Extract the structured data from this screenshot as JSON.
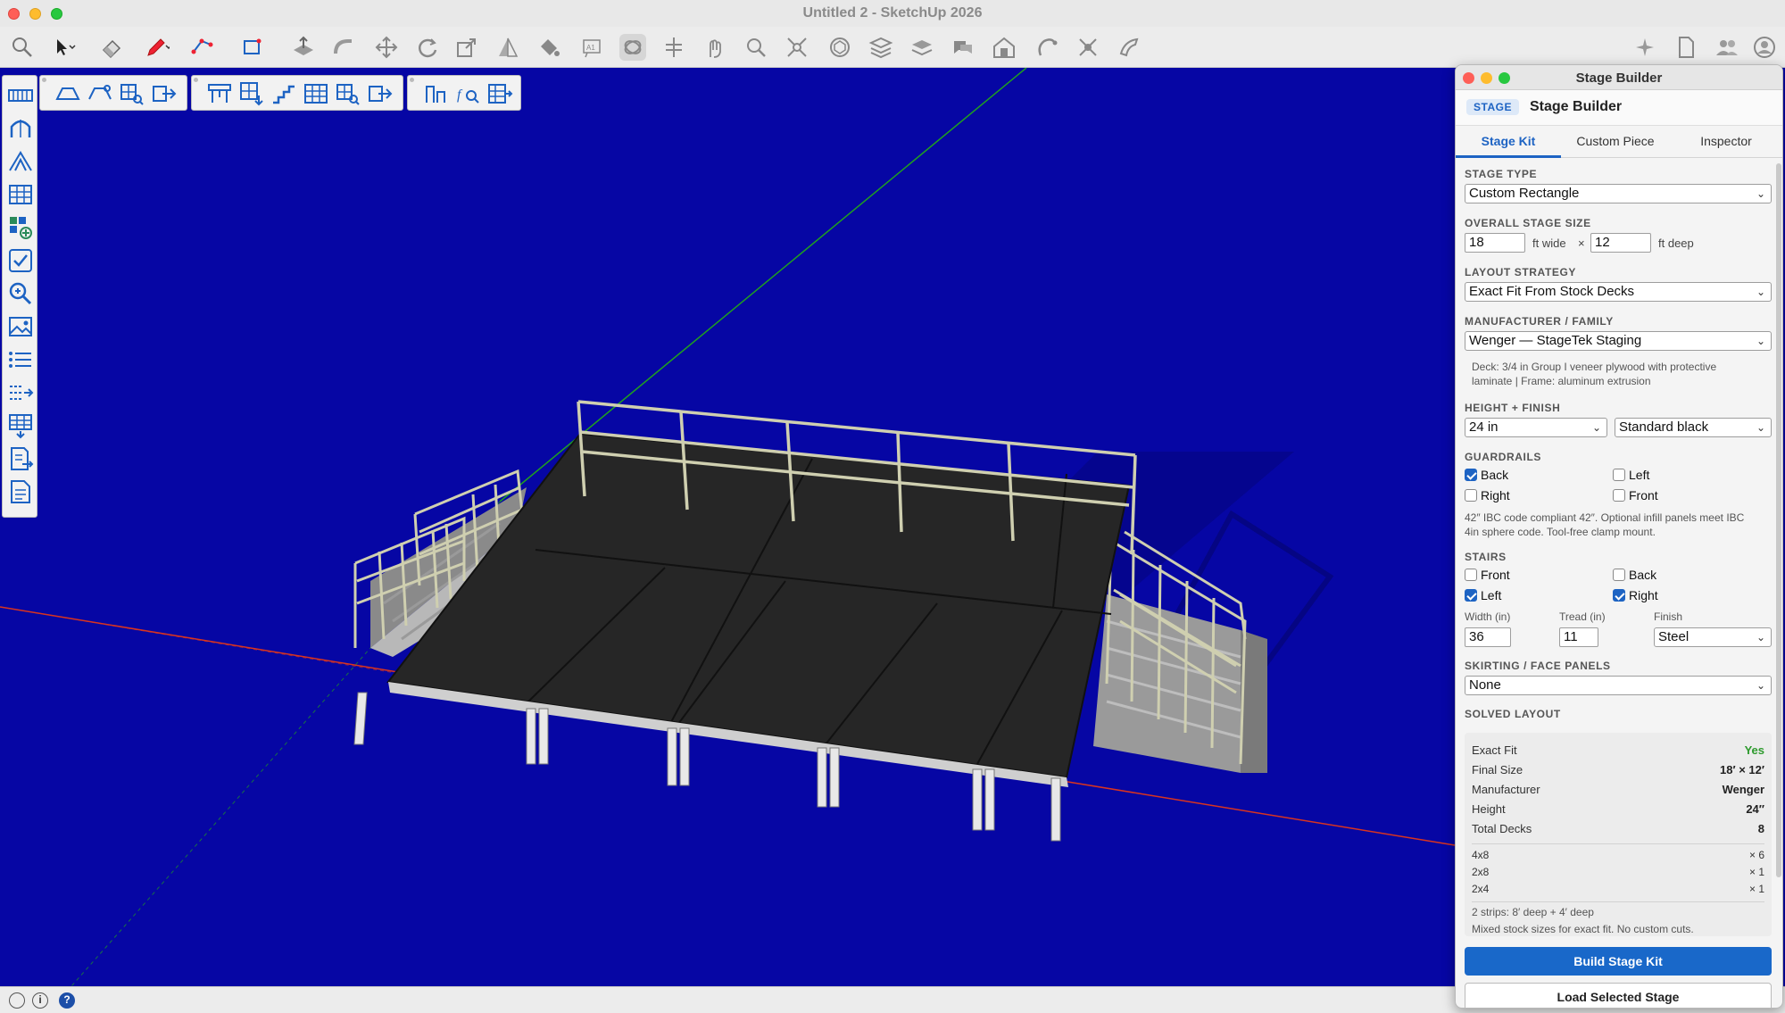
{
  "window": {
    "title": "Untitled 2 - SketchUp 2026"
  },
  "colors": {
    "accent": "#1d63c3",
    "viewport_bg": "#0606a4",
    "green_ok": "#2d9a2d"
  },
  "toolbar": {
    "icons": [
      "search-icon",
      "select-arrow-icon",
      "eraser-icon",
      "pencil-icon",
      "line-icon",
      "rectangle-icon",
      "push-pull-icon",
      "follow-me-icon",
      "move-icon",
      "rotate-icon",
      "scale-icon",
      "section-icon",
      "paint-icon",
      "text-icon",
      "orbit-icon",
      "pan-icon",
      "walk-icon",
      "zoom-icon",
      "zoom-extents-icon",
      "components-icon",
      "layers-icon",
      "tags-icon",
      "materials-icon",
      "warehouse-icon",
      "extension-icon",
      "styles-icon",
      "sandbox-icon"
    ],
    "right_icons": [
      "sparkle-icon",
      "document-icon",
      "users-icon",
      "profile-icon"
    ]
  },
  "panel": {
    "window_title": "Stage Builder",
    "badge": "STAGE",
    "header_title": "Stage Builder",
    "tabs": [
      {
        "label": "Stage Kit",
        "active": true
      },
      {
        "label": "Custom Piece",
        "active": false
      },
      {
        "label": "Inspector",
        "active": false
      }
    ],
    "stage_type": {
      "label": "STAGE TYPE",
      "value": "Custom Rectangle"
    },
    "size": {
      "label": "OVERALL STAGE SIZE",
      "width": "18",
      "width_unit": "ft wide",
      "times": "×",
      "depth": "12",
      "depth_unit": "ft deep"
    },
    "layout": {
      "label": "LAYOUT STRATEGY",
      "value": "Exact Fit From Stock Decks"
    },
    "manufacturer": {
      "label": "MANUFACTURER / FAMILY",
      "value": "Wenger — StageTek Staging",
      "note_line1": "Deck: 3/4 in Group I veneer plywood with protective",
      "note_line2": "laminate | Frame: aluminum extrusion"
    },
    "height_finish": {
      "label": "HEIGHT + FINISH",
      "height": "24 in",
      "finish": "Standard black"
    },
    "guardrails": {
      "label": "GUARDRAILS",
      "back": {
        "label": "Back",
        "checked": true
      },
      "left": {
        "label": "Left",
        "checked": false
      },
      "right": {
        "label": "Right",
        "checked": false
      },
      "front": {
        "label": "Front",
        "checked": false
      },
      "note_line1": "42″ IBC code compliant 42″. Optional infill panels meet IBC",
      "note_line2": "4in sphere code. Tool-free clamp mount."
    },
    "stairs": {
      "label": "STAIRS",
      "front": {
        "label": "Front",
        "checked": false
      },
      "back": {
        "label": "Back",
        "checked": false
      },
      "left": {
        "label": "Left",
        "checked": true
      },
      "right": {
        "label": "Right",
        "checked": true
      },
      "width_label": "Width (in)",
      "width": "36",
      "tread_label": "Tread (in)",
      "tread": "11",
      "finish_label": "Finish",
      "finish": "Steel"
    },
    "skirting": {
      "label": "SKIRTING / FACE PANELS",
      "value": "None"
    },
    "solved": {
      "label": "SOLVED LAYOUT",
      "exact_fit": {
        "k": "Exact Fit",
        "v": "Yes"
      },
      "final_size": {
        "k": "Final Size",
        "v": "18′ × 12′"
      },
      "manufacturer": {
        "k": "Manufacturer",
        "v": "Wenger"
      },
      "height": {
        "k": "Height",
        "v": "24″"
      },
      "total_decks": {
        "k": "Total Decks",
        "v": "8"
      },
      "decks": [
        {
          "size": "4x8",
          "count": "× 6"
        },
        {
          "size": "2x8",
          "count": "× 1"
        },
        {
          "size": "2x4",
          "count": "× 1"
        }
      ],
      "note1": "2 strips: 8′ deep + 4′ deep",
      "note2": "Mixed stock sizes for exact fit. No custom cuts."
    },
    "build_button": "Build Stage Kit",
    "load_button": "Load Selected Stage"
  },
  "statusbar": {
    "info_glyph": "i",
    "help_glyph": "?"
  }
}
